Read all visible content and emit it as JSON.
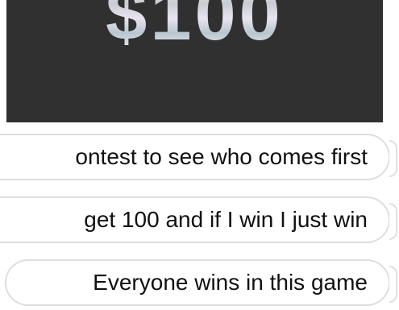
{
  "media": {
    "text": "$100"
  },
  "replies": [
    {
      "text": "ontest to see who comes first"
    },
    {
      "text": "get 100 and if I win I just win"
    },
    {
      "text": "Everyone wins in this game"
    }
  ]
}
